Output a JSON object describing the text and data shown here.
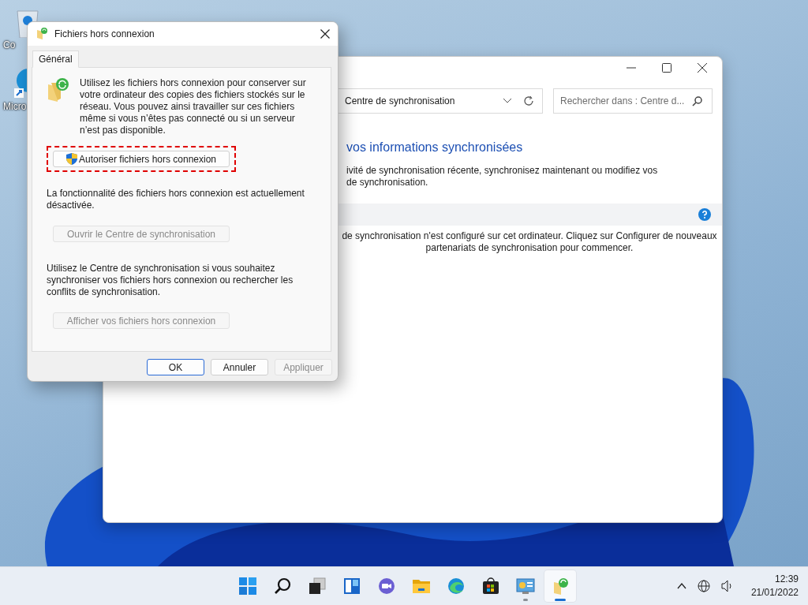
{
  "desktop": {
    "icons": [
      {
        "label": "Co",
        "kind": "bin"
      },
      {
        "label": "Micro",
        "kind": "edge"
      }
    ]
  },
  "sync_center": {
    "address": "Centre de synchronisation",
    "search": {
      "placeholder": "Rechercher dans : Centre d..."
    },
    "heading": "vos informations synchronisées",
    "description": [
      "ivité de synchronisation récente, synchronisez maintenant ou modifiez vos",
      "de synchronisation."
    ],
    "message": [
      "de synchronisation n'est configuré sur cet ordinateur. Cliquez sur Configurer de nouveaux",
      "partenariats de synchronisation pour commencer."
    ]
  },
  "dialog": {
    "title": "Fichiers hors connexion",
    "tabs": [
      {
        "label": "Général",
        "selected": true
      }
    ],
    "intro": "Utilisez les fichiers hors connexion pour conserver sur votre ordinateur des copies des fichiers stockés sur le réseau. Vous pouvez ainsi travailler sur ces fichiers même si vous n’êtes pas connecté ou si un serveur n’est pas disponible.",
    "sections": [
      {
        "button": {
          "label": "Autoriser fichiers hors connexion",
          "disabled": false,
          "shield": true,
          "highlighted": true
        },
        "text": "La fonctionnalité des fichiers hors connexion est actuellement désactivée."
      },
      {
        "button": {
          "label": "Ouvrir le Centre de synchronisation",
          "disabled": true,
          "shield": false,
          "highlighted": false
        },
        "text": "Utilisez le Centre de synchronisation si vous souhaitez synchroniser vos fichiers hors connexion ou rechercher les conflits de synchronisation."
      },
      {
        "button": {
          "label": "Afficher vos fichiers hors connexion",
          "disabled": true,
          "shield": false,
          "highlighted": false
        }
      }
    ],
    "footer_buttons": [
      {
        "label": "OK",
        "default": true,
        "disabled": false
      },
      {
        "label": "Annuler",
        "default": false,
        "disabled": false
      },
      {
        "label": "Appliquer",
        "default": false,
        "disabled": true
      }
    ]
  },
  "taskbar": {
    "apps": [
      {
        "kind": "start",
        "running": false,
        "selected": false
      },
      {
        "kind": "search",
        "running": false,
        "selected": false
      },
      {
        "kind": "taskview",
        "running": false,
        "selected": false
      },
      {
        "kind": "widgets",
        "running": false,
        "selected": false
      },
      {
        "kind": "chat",
        "running": false,
        "selected": false
      },
      {
        "kind": "explorer",
        "running": false,
        "selected": false
      },
      {
        "kind": "edge",
        "running": false,
        "selected": false
      },
      {
        "kind": "store",
        "running": false,
        "selected": false
      },
      {
        "kind": "controlpanel",
        "running": true,
        "selected": false
      },
      {
        "kind": "offline",
        "running": true,
        "selected": true
      }
    ],
    "time": "12:39",
    "date": "21/01/2022"
  }
}
